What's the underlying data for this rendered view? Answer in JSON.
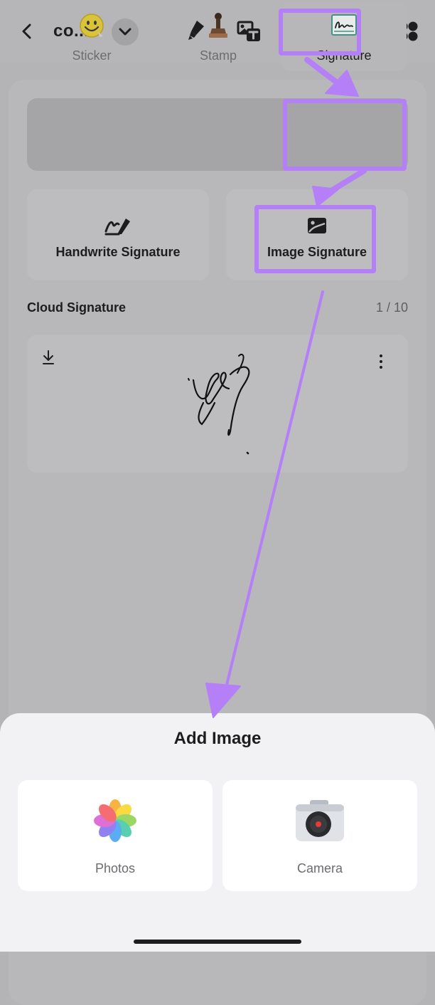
{
  "toolbar": {
    "title": "co...",
    "icons": [
      "back-arrow-icon",
      "chevron-down-icon",
      "highlighter-icon",
      "text-box-icon",
      "add-image-icon",
      "chevron-down-icon",
      "apps-grid-icon"
    ]
  },
  "panel": {
    "tabs": [
      {
        "label": "Sticker",
        "icon": "smiley-sticker-icon",
        "active": false
      },
      {
        "label": "Stamp",
        "icon": "stamp-icon",
        "active": false
      },
      {
        "label": "Signature",
        "icon": "signature-icon",
        "active": true
      }
    ],
    "options": [
      {
        "label": "Handwrite Signature",
        "icon": "handwrite-icon"
      },
      {
        "label": "Image Signature",
        "icon": "image-icon"
      }
    ],
    "cloud": {
      "label": "Cloud Signature",
      "count": "1 / 10"
    }
  },
  "sheet": {
    "title": "Add Image",
    "options": [
      {
        "label": "Photos",
        "icon": "photos-app-icon"
      },
      {
        "label": "Camera",
        "icon": "camera-app-icon"
      }
    ]
  },
  "colors": {
    "highlight": "#b47ff7",
    "sheet_background": "#f2f2f4",
    "dim_overlay": "#b6b6b8"
  }
}
